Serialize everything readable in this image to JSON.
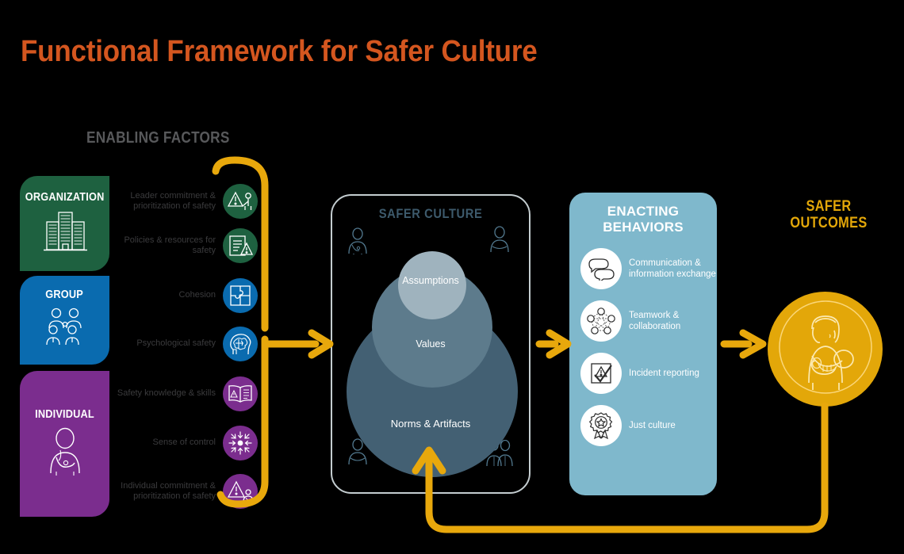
{
  "title": "Functional Framework for Safer Culture",
  "colors": {
    "title_orange": "#D4561F",
    "organization_green": "#1E6140",
    "group_blue": "#0A6BAF",
    "individual_purple": "#7B2D8E",
    "arrow_yellow": "#E8A80C",
    "outcomes_gold": "#E3A709",
    "behaviors_blue": "#7FB8CC",
    "culture_border": "#C4CDD0",
    "venn_outer": "#436073",
    "venn_mid": "#5D7B8C",
    "venn_inner": "#9FB3BE",
    "header_gray": "#58595B",
    "label_gray": "#3B3B3D"
  },
  "enabling": {
    "header": "ENABLING FACTORS",
    "categories": [
      {
        "label": "ORGANIZATION",
        "icon": "office-buildings-icon",
        "color": "#1E6140"
      },
      {
        "label": "GROUP",
        "icon": "group-of-clinicians-icon",
        "color": "#0A6BAF"
      },
      {
        "label": "INDIVIDUAL",
        "icon": "clinician-icon",
        "color": "#7B2D8E"
      }
    ],
    "factors": [
      {
        "label": "Leader commitment & prioritization of safety",
        "icon": "warning-triangle-leader-icon",
        "tone": "green"
      },
      {
        "label": "Policies & resources for safety",
        "icon": "document-warning-icon",
        "tone": "green"
      },
      {
        "label": "Cohesion",
        "icon": "puzzle-pieces-icon",
        "tone": "blue"
      },
      {
        "label": "Psychological safety",
        "icon": "head-brain-icon",
        "tone": "blue"
      },
      {
        "label": "Safety knowledge & skills",
        "icon": "open-book-warning-icon",
        "tone": "purple"
      },
      {
        "label": "Sense of control",
        "icon": "converging-arrows-icon",
        "tone": "purple"
      },
      {
        "label": "Individual commitment & prioritization of safety",
        "icon": "warning-triangle-person-icon",
        "tone": "purple"
      }
    ]
  },
  "culture": {
    "title": "SAFER CULTURE",
    "layers": [
      {
        "label": "Assumptions",
        "level": "inner"
      },
      {
        "label": "Values",
        "level": "middle"
      },
      {
        "label": "Norms & Artifacts",
        "level": "outer"
      }
    ],
    "corner_icons": [
      "person-top-left-icon",
      "person-top-right-icon",
      "person-bottom-left-icon",
      "people-bottom-right-icon"
    ]
  },
  "behaviors": {
    "title_line1": "ENACTING",
    "title_line2": "BEHAVIORS",
    "items": [
      {
        "label": "Communication & information exchange",
        "icon": "speech-bubbles-icon"
      },
      {
        "label": "Teamwork & collaboration",
        "icon": "network-nodes-icon"
      },
      {
        "label": "Incident reporting",
        "icon": "clipboard-check-warning-icon"
      },
      {
        "label": "Just culture",
        "icon": "award-ribbon-icon"
      }
    ]
  },
  "outcomes": {
    "title_line1": "SAFER",
    "title_line2": "OUTCOMES",
    "icon": "mother-holding-baby-icon"
  },
  "flow": {
    "arrow_enabling_to_culture": "arrow-right",
    "arrow_culture_to_behaviors": "arrow-right",
    "arrow_behaviors_to_outcomes": "arrow-right",
    "feedback_arrow": "arrow-up-feedback-loop"
  }
}
